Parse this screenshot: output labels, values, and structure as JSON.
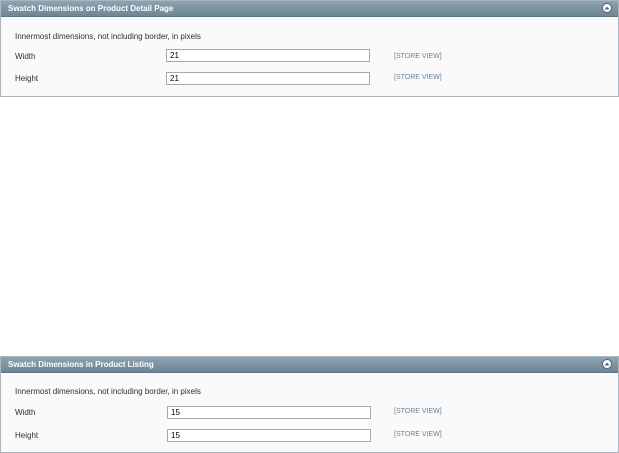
{
  "sections": [
    {
      "title": "Swatch Dimensions on Product Detail Page",
      "comment": "Innermost dimensions, not including border, in pixels",
      "fields": [
        {
          "label": "Width",
          "value": "21",
          "scope": "[STORE VIEW]"
        },
        {
          "label": "Height",
          "value": "21",
          "scope": "[STORE VIEW]"
        }
      ]
    },
    {
      "title": "Swatch Dimensions in Product Listing",
      "comment": "Innermost dimensions, not including border, in pixels",
      "fields": [
        {
          "label": "Width",
          "value": "15",
          "scope": "[STORE VIEW]"
        },
        {
          "label": "Height",
          "value": "15",
          "scope": "[STORE VIEW]"
        }
      ]
    }
  ],
  "icons": {
    "collapse": "chevron-up-icon"
  },
  "colors": {
    "header_bg": "#7a8f9c",
    "scope_text": "#6a8194",
    "panel_bg": "#fafafa"
  }
}
